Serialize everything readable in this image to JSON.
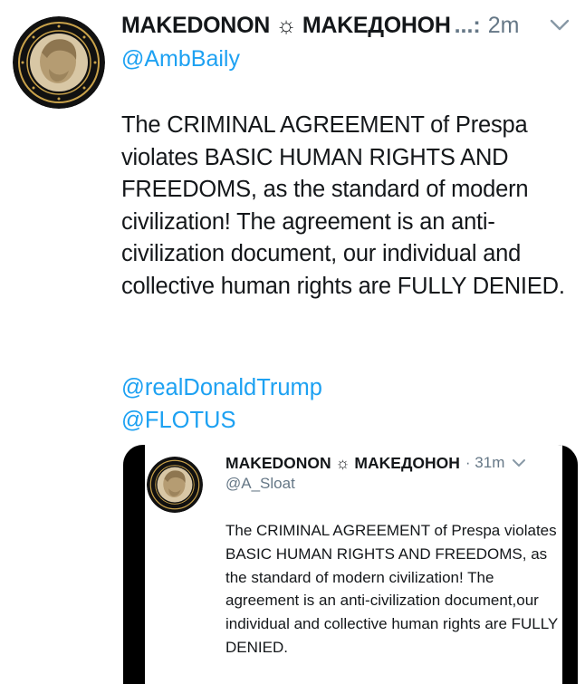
{
  "tweet": {
    "display_name": "MAKEDONON ☼ MAKEДОНОН",
    "ellipsis": "...:",
    "timestamp": "2m",
    "handle": "@AmbBaily",
    "text": "The CRIMINAL AGREEMENT of Prespa violates BASIC HUMAN RIGHTS AND FREEDOMS, as the standard of modern civilization! The agreement is an anti-civilization document, our individual and collective human rights are FULLY DENIED.",
    "mentions": [
      "@realDonaldTrump",
      "@FLOTUS"
    ]
  },
  "embedded": {
    "display_name": "MAKEDONON ☼ MAKEДОНОН",
    "timestamp": "· 31m",
    "handle": "@A_Sloat",
    "text": "The CRIMINAL AGREEMENT of Prespa violates BASIC HUMAN RIGHTS AND FREEDOMS, as the standard of modern civilization! The agreement is an anti-civilization document,our individual and collective human rights are FULLY DENIED."
  },
  "icons": {
    "more": "chevron-down-icon",
    "avatar": "coin-avatar-icon"
  },
  "colors": {
    "link": "#1da1f2",
    "muted": "#657786",
    "text": "#14171a"
  }
}
